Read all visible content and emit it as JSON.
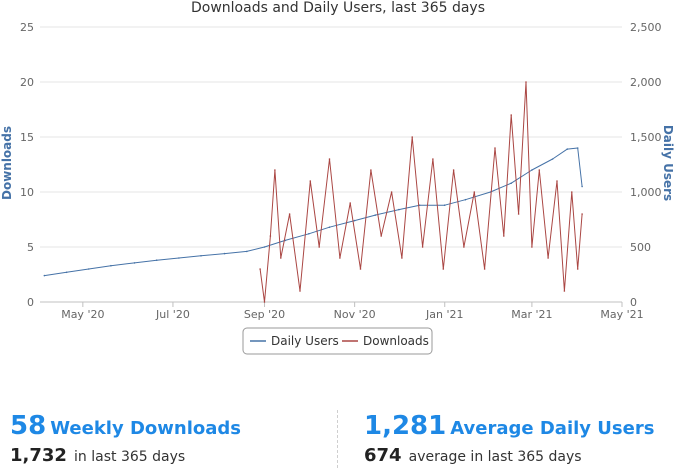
{
  "chart_data": {
    "type": "line",
    "title": "Downloads and Daily Users, last 365 days",
    "y_left_label": "Downloads",
    "y_right_label": "Daily Users",
    "y_left_range": [
      0,
      25
    ],
    "y_right_range": [
      0,
      2500
    ],
    "y_left_ticks": [
      "0",
      "5",
      "10",
      "15",
      "20",
      "25"
    ],
    "y_right_ticks": [
      "0",
      "500",
      "1,000",
      "1,500",
      "2,000",
      "2,500"
    ],
    "x_range": [
      "2020-04-02",
      "2021-05-01"
    ],
    "x_ticks": [
      {
        "date": "2020-05-01",
        "label": "May '20"
      },
      {
        "date": "2020-07-01",
        "label": "Jul '20"
      },
      {
        "date": "2020-09-01",
        "label": "Sep '20"
      },
      {
        "date": "2020-11-01",
        "label": "Nov '20"
      },
      {
        "date": "2021-01-01",
        "label": "Jan '21"
      },
      {
        "date": "2021-03-01",
        "label": "Mar '21"
      },
      {
        "date": "2021-05-01",
        "label": "May '21"
      }
    ],
    "grid": true,
    "legend_position": "bottom-center",
    "series": [
      {
        "name": "Daily Users",
        "axis": "right",
        "color": "#4572A7",
        "points": [
          [
            "2020-04-05",
            240
          ],
          [
            "2020-04-20",
            270
          ],
          [
            "2020-05-05",
            300
          ],
          [
            "2020-05-20",
            330
          ],
          [
            "2020-06-05",
            355
          ],
          [
            "2020-06-20",
            380
          ],
          [
            "2020-07-05",
            400
          ],
          [
            "2020-07-20",
            420
          ],
          [
            "2020-08-05",
            440
          ],
          [
            "2020-08-20",
            460
          ],
          [
            "2020-09-01",
            500
          ],
          [
            "2020-09-15",
            560
          ],
          [
            "2020-10-01",
            620
          ],
          [
            "2020-10-15",
            680
          ],
          [
            "2020-11-01",
            740
          ],
          [
            "2020-11-15",
            790
          ],
          [
            "2020-12-01",
            840
          ],
          [
            "2020-12-15",
            880
          ],
          [
            "2021-01-01",
            880
          ],
          [
            "2021-01-15",
            930
          ],
          [
            "2021-02-01",
            1000
          ],
          [
            "2021-02-15",
            1080
          ],
          [
            "2021-03-01",
            1200
          ],
          [
            "2021-03-15",
            1300
          ],
          [
            "2021-03-25",
            1390
          ],
          [
            "2021-04-01",
            1400
          ],
          [
            "2021-04-04",
            1050
          ]
        ]
      },
      {
        "name": "Downloads",
        "axis": "left",
        "color": "#AA4643",
        "points": [
          [
            "2020-08-29",
            3
          ],
          [
            "2020-09-01",
            0
          ],
          [
            "2020-09-05",
            6
          ],
          [
            "2020-09-08",
            12
          ],
          [
            "2020-09-12",
            4
          ],
          [
            "2020-09-18",
            8
          ],
          [
            "2020-09-25",
            1
          ],
          [
            "2020-10-02",
            11
          ],
          [
            "2020-10-08",
            5
          ],
          [
            "2020-10-15",
            13
          ],
          [
            "2020-10-22",
            4
          ],
          [
            "2020-10-29",
            9
          ],
          [
            "2020-11-05",
            3
          ],
          [
            "2020-11-12",
            12
          ],
          [
            "2020-11-19",
            6
          ],
          [
            "2020-11-26",
            10
          ],
          [
            "2020-12-03",
            4
          ],
          [
            "2020-12-10",
            15
          ],
          [
            "2020-12-17",
            5
          ],
          [
            "2020-12-24",
            13
          ],
          [
            "2020-12-31",
            3
          ],
          [
            "2021-01-07",
            12
          ],
          [
            "2021-01-14",
            5
          ],
          [
            "2021-01-21",
            10
          ],
          [
            "2021-01-28",
            3
          ],
          [
            "2021-02-04",
            14
          ],
          [
            "2021-02-10",
            6
          ],
          [
            "2021-02-15",
            17
          ],
          [
            "2021-02-20",
            8
          ],
          [
            "2021-02-25",
            20
          ],
          [
            "2021-03-01",
            5
          ],
          [
            "2021-03-06",
            12
          ],
          [
            "2021-03-12",
            4
          ],
          [
            "2021-03-18",
            11
          ],
          [
            "2021-03-23",
            1
          ],
          [
            "2021-03-28",
            10
          ],
          [
            "2021-04-01",
            3
          ],
          [
            "2021-04-04",
            8
          ]
        ]
      }
    ]
  },
  "stats": {
    "weekly_downloads_value": "58",
    "weekly_downloads_label": "Weekly Downloads",
    "total_downloads_value": "1,732",
    "total_downloads_label": "in last 365 days",
    "avg_users_value": "1,281",
    "avg_users_label": "Average Daily Users",
    "avg_users_sub_value": "674",
    "avg_users_sub_label": "average in last 365 days"
  },
  "colors": {
    "users_line": "#4572A7",
    "downloads_line": "#AA4643",
    "stat_accent": "#1e88e5"
  }
}
